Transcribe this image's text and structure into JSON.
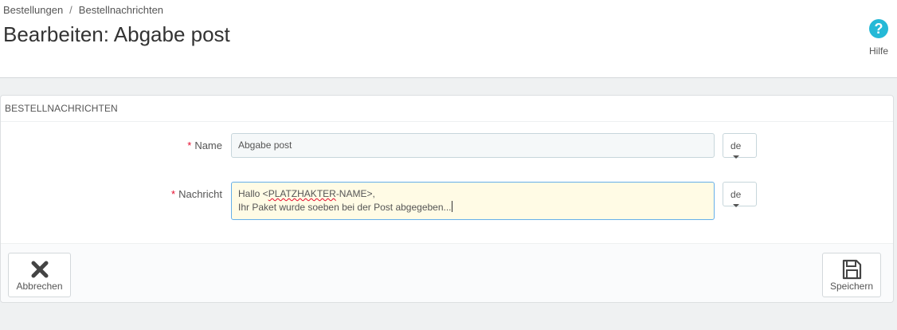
{
  "breadcrumb": {
    "items": [
      "Bestellungen",
      "Bestellnachrichten"
    ],
    "separator": "/"
  },
  "page_title": "Bearbeiten: Abgabe post",
  "help": {
    "label": "Hilfe",
    "icon": "question-circle-icon",
    "color": "#25b9d7"
  },
  "panel": {
    "heading": "Bestellnachrichten",
    "name_field": {
      "label": "Name",
      "required_marker": "*",
      "value": "Abgabe post",
      "lang": "de"
    },
    "message_field": {
      "label": "Nachricht",
      "required_marker": "*",
      "line1_prefix": "Hallo <",
      "line1_misspelled": "PLATZHAKTER",
      "line1_suffix": "-NAME>,",
      "line2": "Ihr Paket wurde soeben bei der Post abgegeben...",
      "lang": "de"
    }
  },
  "footer": {
    "cancel_label": "Abbrechen",
    "cancel_icon": "close-icon",
    "save_label": "Speichern",
    "save_icon": "floppy-disk-icon"
  },
  "colors": {
    "required": "#e50b2d",
    "accent": "#25b9d7",
    "focus_border": "#66afe9",
    "focus_bg": "#fffbe5"
  }
}
